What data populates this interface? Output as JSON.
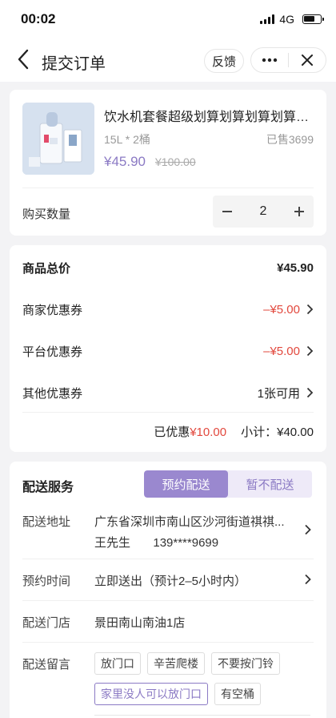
{
  "status": {
    "time": "00:02",
    "network": "4G"
  },
  "nav": {
    "title": "提交订单",
    "feedback": "反馈"
  },
  "product": {
    "name": "饮水机套餐超级划算划算划算划算划算划算",
    "spec": "15L * 2桶",
    "sold": "已售3699",
    "price": "¥45.90",
    "original_price": "¥100.00"
  },
  "quantity": {
    "label": "购买数量",
    "value": "2"
  },
  "pricing": {
    "total_label": "商品总价",
    "total_value": "¥45.90",
    "merchant_label": "商家优惠券",
    "merchant_value": "–¥5.00",
    "platform_label": "平台优惠券",
    "platform_value": "–¥5.00",
    "other_label": "其他优惠券",
    "other_value": "1张可用",
    "discount_label": "已优惠",
    "discount_value": "¥10.00",
    "subtotal_label": "小计：",
    "subtotal_value": "¥40.00"
  },
  "delivery": {
    "title": "配送服务",
    "options": [
      "预约配送",
      "暂不配送"
    ],
    "selected_option": "预约配送",
    "address_label": "配送地址",
    "address": "广东省深圳市南山区沙河街道祺祺...",
    "contact_name": "王先生",
    "contact_phone": "139****9699",
    "time_label": "预约时间",
    "time_value": "立即送出（预计2–5小时内）",
    "store_label": "配送门店",
    "store_value": "景田南山南油1店",
    "note_label": "配送留言",
    "tags": [
      "放门口",
      "辛苦爬楼",
      "不要按门铃",
      "家里没人可以放门口",
      "有空桶"
    ],
    "selected_tag": "家里没人可以放门口"
  },
  "colors": {
    "accent": "#8b7ac4",
    "discount_red": "#e2483d",
    "background": "#f3f3f5"
  }
}
